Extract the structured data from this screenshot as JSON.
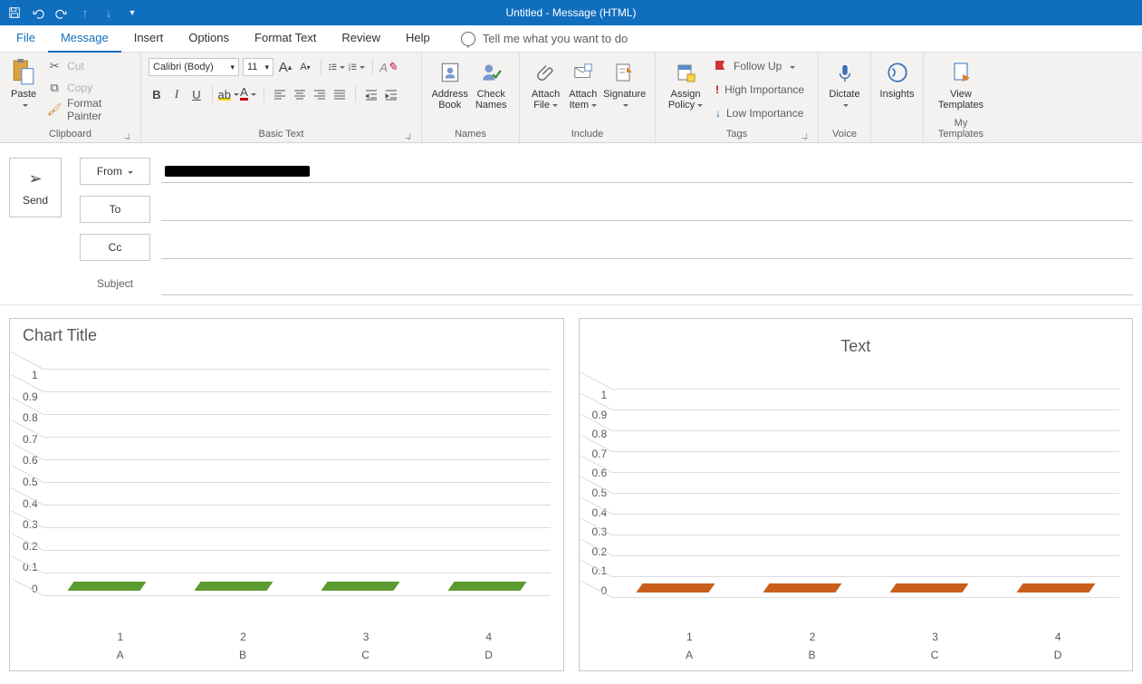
{
  "title": "Untitled  -  Message (HTML)",
  "qat": {
    "save": "save-icon",
    "undo": "undo-icon",
    "redo": "redo-icon",
    "prev": "prev-icon",
    "next": "next-icon",
    "more": "more-icon"
  },
  "tabs": {
    "file": "File",
    "message": "Message",
    "insert": "Insert",
    "options": "Options",
    "format_text": "Format Text",
    "review": "Review",
    "help": "Help",
    "tell_me": "Tell me what you want to do"
  },
  "ribbon": {
    "clipboard": {
      "label": "Clipboard",
      "paste": "Paste",
      "cut": "Cut",
      "copy": "Copy",
      "format_painter": "Format Painter"
    },
    "basic_text": {
      "label": "Basic Text",
      "font_name": "Calibri (Body)",
      "font_size": "11"
    },
    "names": {
      "label": "Names",
      "address_book_l1": "Address",
      "address_book_l2": "Book",
      "check_names_l1": "Check",
      "check_names_l2": "Names"
    },
    "include": {
      "label": "Include",
      "attach_file_l1": "Attach",
      "attach_file_l2": "File",
      "attach_item_l1": "Attach",
      "attach_item_l2": "Item",
      "signature": "Signature"
    },
    "tags": {
      "label": "Tags",
      "assign_l1": "Assign",
      "assign_l2": "Policy",
      "follow_up": "Follow Up",
      "high_importance": "High Importance",
      "low_importance": "Low Importance"
    },
    "voice": {
      "label": "Voice",
      "dictate": "Dictate"
    },
    "insights": {
      "label": "",
      "insights": "Insights"
    },
    "templates": {
      "label": "My Templates",
      "view_l1": "View",
      "view_l2": "Templates"
    }
  },
  "mail": {
    "send": "Send",
    "from": "From",
    "to": "To",
    "cc": "Cc",
    "subject": "Subject"
  },
  "chart_data": [
    {
      "type": "bar",
      "title": "Chart Title",
      "color": "#5b9b2f",
      "ylim": [
        0,
        1
      ],
      "yticks": [
        0,
        0.1,
        0.2,
        0.3,
        0.4,
        0.5,
        0.6,
        0.7,
        0.8,
        0.9,
        1
      ],
      "categories_primary": [
        "1",
        "2",
        "3",
        "4"
      ],
      "categories_secondary": [
        "A",
        "B",
        "C",
        "D"
      ],
      "values": [
        0.05,
        0.05,
        0.05,
        0.05
      ]
    },
    {
      "type": "bar",
      "title": "Text",
      "color": "#c95e1d",
      "ylim": [
        0,
        1
      ],
      "yticks": [
        0,
        0.1,
        0.2,
        0.3,
        0.4,
        0.5,
        0.6,
        0.7,
        0.8,
        0.9,
        1
      ],
      "categories_primary": [
        "1",
        "2",
        "3",
        "4"
      ],
      "categories_secondary": [
        "A",
        "B",
        "C",
        "D"
      ],
      "values": [
        0.05,
        0.05,
        0.05,
        0.05
      ]
    }
  ]
}
